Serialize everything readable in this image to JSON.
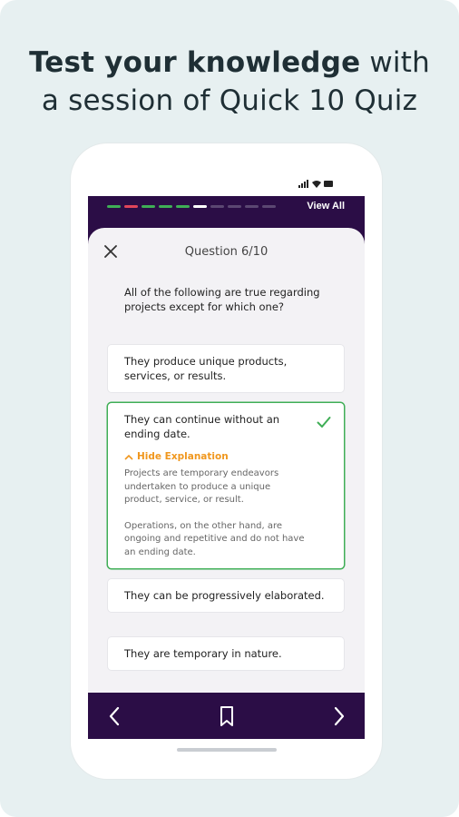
{
  "headline": {
    "bold": "Test your knowledge",
    "rest_line1": " with",
    "line2": "a session of Quick 10 Quiz"
  },
  "status_bar": {
    "icons": "signal-icon wifi-icon battery-icon"
  },
  "quiz": {
    "view_all_label": "View All",
    "progress": [
      {
        "state": "correct",
        "color": "#3fae56"
      },
      {
        "state": "wrong",
        "color": "#e0455a"
      },
      {
        "state": "correct",
        "color": "#3fae56"
      },
      {
        "state": "correct",
        "color": "#3fae56"
      },
      {
        "state": "correct",
        "color": "#3fae56"
      },
      {
        "state": "current",
        "color": "#ffffff"
      },
      {
        "state": "pending",
        "color": "#5b4772"
      },
      {
        "state": "pending",
        "color": "#5b4772"
      },
      {
        "state": "pending",
        "color": "#5b4772"
      },
      {
        "state": "pending",
        "color": "#5b4772"
      }
    ],
    "question_number": "Question 6/10",
    "question_text": "All of the following are true regarding projects except for which one?",
    "options": [
      {
        "text": "They produce unique products, services, or results."
      },
      {
        "text": "They can continue without an ending date.",
        "selected": true,
        "explanation_toggle": "Hide Explanation",
        "explanation_p1": "Projects are temporary endeavors undertaken to produce a unique product, service, or result.",
        "explanation_p2": "Operations, on the other hand, are ongoing and repetitive and do not have an ending date."
      },
      {
        "text": "They can be progressively elaborated."
      },
      {
        "text": "They are temporary in nature."
      }
    ]
  },
  "colors": {
    "topbar": "#2b0d46",
    "correct": "#3fae56",
    "accent": "#f0971e",
    "background": "#e7f0f1"
  },
  "icons": {
    "close": "close-icon",
    "check": "check-icon",
    "chevron_up": "chevron-up-icon",
    "prev": "chevron-left-icon",
    "bookmark": "bookmark-icon",
    "next": "chevron-right-icon"
  }
}
